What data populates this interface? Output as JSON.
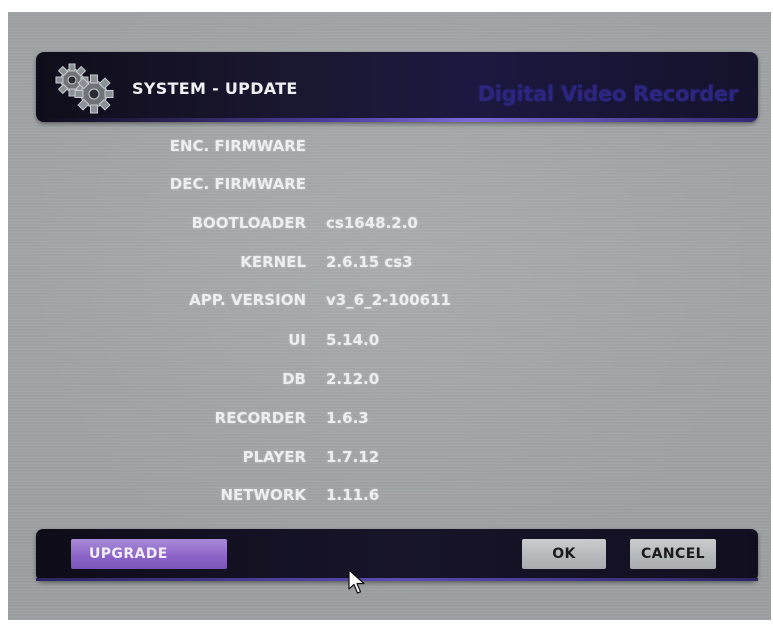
{
  "header": {
    "title": "SYSTEM - UPDATE",
    "brand": "Digital Video Recorder"
  },
  "info_rows": [
    {
      "label": "ENC. FIRMWARE",
      "value": ""
    },
    {
      "label": "DEC. FIRMWARE",
      "value": ""
    },
    {
      "label": "BOOTLOADER",
      "value": "cs1648.2.0"
    },
    {
      "label": "KERNEL",
      "value": "2.6.15 cs3"
    },
    {
      "label": "APP. VERSION",
      "value": "v3_6_2-100611"
    },
    {
      "label": "UI",
      "value": "5.14.0"
    },
    {
      "label": "DB",
      "value": "2.12.0"
    },
    {
      "label": "RECORDER",
      "value": "1.6.3"
    },
    {
      "label": "PLAYER",
      "value": "1.7.12"
    },
    {
      "label": "NETWORK",
      "value": "1.11.6"
    }
  ],
  "footer": {
    "upgrade_label": "UPGRADE",
    "ok_label": "OK",
    "cancel_label": "CANCEL"
  },
  "colors": {
    "accent": "#8b63c6",
    "header_bg": "#1a1730",
    "screen_bg": "#a0a3a4"
  },
  "icons": {
    "header": "gear-icon",
    "pointer": "mouse-cursor-icon"
  }
}
